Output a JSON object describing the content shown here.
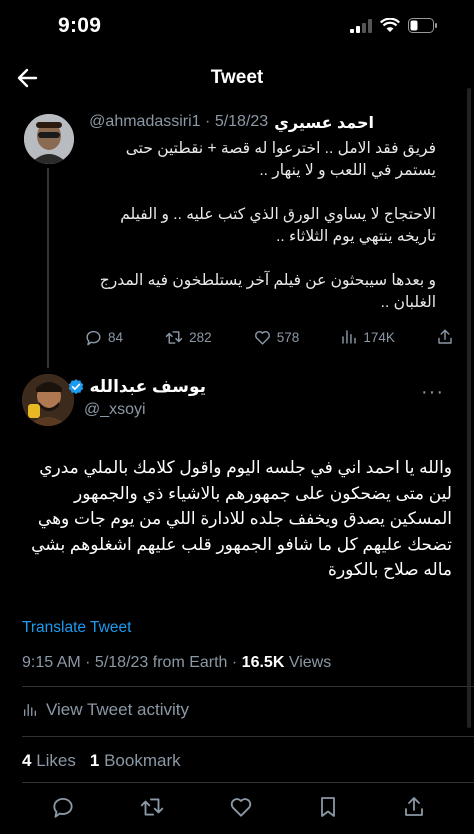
{
  "status_bar": {
    "time": "9:09"
  },
  "header": {
    "title": "Tweet"
  },
  "parent_tweet": {
    "name": "احمد عسيري",
    "handle": "@ahmadassiri1",
    "separator": "·",
    "date": "5/18/23",
    "paragraphs": [
      "فريق فقد الامل .. اخترعوا له قصة + نقطتين حتى يستمر في اللعب و لا ينهار ..",
      "الاحتجاج لا يساوي الورق الذي كتب عليه .. و الفيلم تاريخه ينتهي يوم الثلاثاء ..",
      "و بعدها سيبحثون عن فيلم آخر يستلطخون فيه المدرج الغلبان .."
    ],
    "actions": {
      "replies": "84",
      "retweets": "282",
      "likes": "578",
      "views": "174K"
    }
  },
  "reply_tweet": {
    "name": "يوسف عبدالله",
    "handle": "@_xsoyi",
    "more": "···",
    "text": "والله يا احمد اني في جلسه اليوم واقول كلامك بالملي مدري لين متى يضحكون على جمهورهم بالاشياء ذي والجمهور المسكين يصدق ويخفف جلده للادارة اللي من يوم جات وهي تضحك عليهم كل ما شافو الجمهور قلب عليهم اشغلوهم بشي ماله صلاح بالكورة",
    "translate_label": "Translate Tweet",
    "time": "9:15 AM",
    "date": "5/18/23",
    "source": "from Earth",
    "views_count": "16.5K",
    "views_label": "Views",
    "activity_label": "View Tweet activity",
    "likes_count": "4",
    "likes_label": "Likes",
    "bookmarks_count": "1",
    "bookmarks_label": "Bookmark"
  },
  "colors": {
    "accent": "#1d9bf0",
    "muted": "#8b98a5",
    "background": "#000000"
  }
}
